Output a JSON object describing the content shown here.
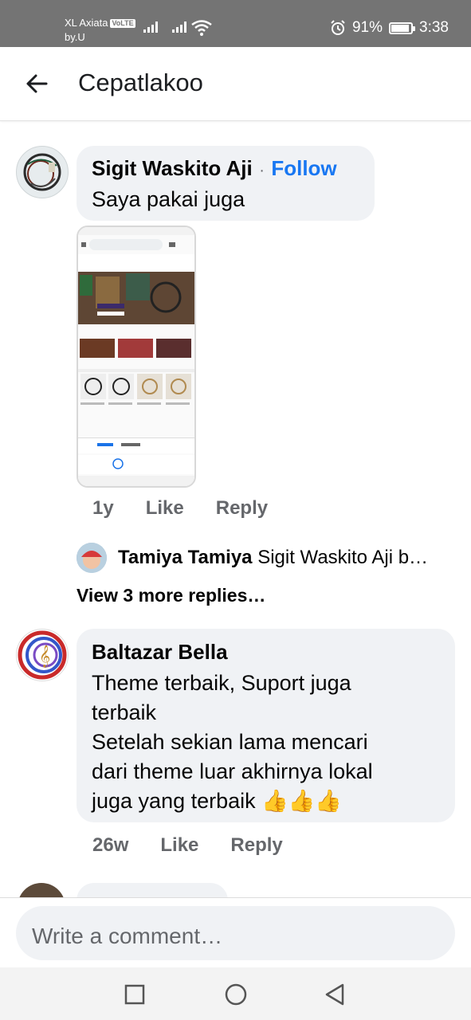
{
  "status_bar": {
    "carrier_line1": "XL Axiata",
    "volte": "VoLTE",
    "carrier_line2": "by.U",
    "battery_percent": "91%",
    "battery_level": 0.91,
    "time": "3:38"
  },
  "app_bar": {
    "title": "Cepatlakoo"
  },
  "comments": [
    {
      "author": "Sigit Waskito Aji",
      "separator": "·",
      "follow_label": "Follow",
      "text": "Saya pakai juga",
      "time": "1y",
      "like_label": "Like",
      "reply_label": "Reply",
      "reply_preview": {
        "author": "Tamiya Tamiya",
        "text": "Sigit Waskito Aji b…"
      },
      "view_more_label": "View 3 more replies…"
    },
    {
      "author": "Baltazar Bella",
      "text_lines": [
        "Theme terbaik, Suport juga",
        "terbaik",
        "Setelah sekian lama mencari",
        "dari theme luar akhirnya lokal"
      ],
      "text_last": "juga yang terbaik",
      "emoji": "👍👍👍",
      "time": "26w",
      "like_label": "Like",
      "reply_label": "Reply"
    }
  ],
  "composer": {
    "placeholder": "Write a comment…"
  },
  "nav_bar": {
    "icons": [
      "square-icon",
      "circle-icon",
      "triangle-back-icon"
    ]
  },
  "colors": {
    "accent": "#1877f2",
    "bubble": "#f0f2f5",
    "secondary_text": "#65676b"
  }
}
